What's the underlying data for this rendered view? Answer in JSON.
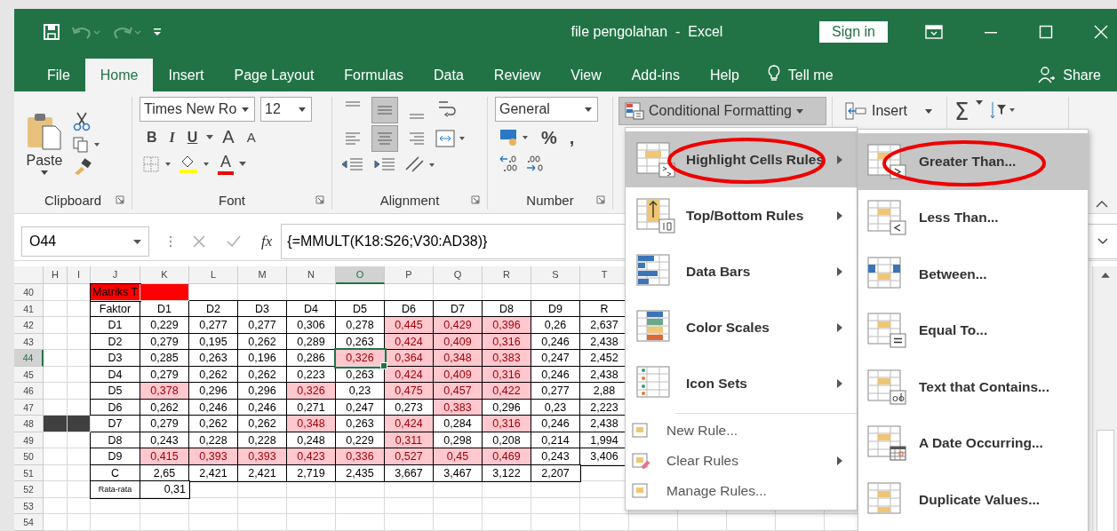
{
  "window": {
    "title": "file pengolahan  -  Excel",
    "sign_in": "Sign in"
  },
  "tabs": [
    {
      "label": "File",
      "selected": false
    },
    {
      "label": "Home",
      "selected": true
    },
    {
      "label": "Insert",
      "selected": false
    },
    {
      "label": "Page Layout",
      "selected": false
    },
    {
      "label": "Formulas",
      "selected": false
    },
    {
      "label": "Data",
      "selected": false
    },
    {
      "label": "Review",
      "selected": false
    },
    {
      "label": "View",
      "selected": false
    },
    {
      "label": "Add-ins",
      "selected": false
    },
    {
      "label": "Help",
      "selected": false
    }
  ],
  "tell_me": "Tell me",
  "share": "Share",
  "ribbon": {
    "clipboard": {
      "label": "Clipboard",
      "paste": "Paste"
    },
    "font": {
      "label": "Font",
      "name": "Times New Ro",
      "size": "12",
      "bold": "B",
      "italic": "I",
      "underline": "U",
      "grow": "A",
      "shrink": "A",
      "color_letter": "A"
    },
    "alignment": {
      "label": "Alignment"
    },
    "number": {
      "label": "Number",
      "format": "General",
      "percent": "%",
      "comma": ","
    },
    "conditional_formatting": {
      "label": "Conditional Formatting",
      "pressed": true
    },
    "insert": "Insert",
    "autosum": "Σ"
  },
  "formula_bar": {
    "name_box": "O44",
    "function_label": "fx",
    "formula": "{=MMULT(K18:S26;V30:AD38)}"
  },
  "sheet": {
    "columns": [
      {
        "label": "H",
        "selected": false
      },
      {
        "label": "I",
        "selected": false
      },
      {
        "label": "J",
        "selected": false
      },
      {
        "label": "K",
        "selected": false
      },
      {
        "label": "L",
        "selected": false
      },
      {
        "label": "M",
        "selected": false
      },
      {
        "label": "N",
        "selected": false
      },
      {
        "label": "O",
        "selected": true
      },
      {
        "label": "P",
        "selected": false
      },
      {
        "label": "Q",
        "selected": false
      },
      {
        "label": "R",
        "selected": false
      },
      {
        "label": "S",
        "selected": false
      },
      {
        "label": "T",
        "selected": false
      }
    ],
    "rows": [
      {
        "number": "40",
        "selected": false,
        "cells": [
          {},
          {},
          {
            "text": "Matriks T",
            "color": "#ff0000"
          },
          {
            "color": "#ff0000"
          }
        ]
      },
      {
        "number": "41",
        "selected": false,
        "cells": [
          {},
          {},
          {
            "text": "Faktor"
          },
          {
            "text": "D1"
          },
          {
            "text": "D2"
          },
          {
            "text": "D3"
          },
          {
            "text": "D4"
          },
          {
            "text": "D5"
          },
          {
            "text": "D6"
          },
          {
            "text": "D7"
          },
          {
            "text": "D8"
          },
          {
            "text": "D9"
          },
          {
            "text": "R"
          }
        ]
      },
      {
        "number": "42",
        "selected": false,
        "cells": [
          {},
          {},
          {
            "text": "D1"
          },
          {
            "text": "0,229",
            "highlighted": false
          },
          {
            "text": "0,277",
            "highlighted": false
          },
          {
            "text": "0,277",
            "highlighted": false
          },
          {
            "text": "0,306",
            "highlighted": false
          },
          {
            "text": "0,278",
            "highlighted": false
          },
          {
            "text": "0,445",
            "highlighted": true
          },
          {
            "text": "0,429",
            "highlighted": true
          },
          {
            "text": "0,396",
            "highlighted": true
          },
          {
            "text": "0,26",
            "highlighted": false
          },
          {
            "text": "2,637"
          }
        ]
      },
      {
        "number": "43",
        "selected": false,
        "cells": [
          {},
          {},
          {
            "text": "D2"
          },
          {
            "text": "0,279",
            "highlighted": false
          },
          {
            "text": "0,195",
            "highlighted": false
          },
          {
            "text": "0,262",
            "highlighted": false
          },
          {
            "text": "0,289",
            "highlighted": false
          },
          {
            "text": "0,263",
            "highlighted": false
          },
          {
            "text": "0,424",
            "highlighted": true
          },
          {
            "text": "0,409",
            "highlighted": true
          },
          {
            "text": "0,316",
            "highlighted": true
          },
          {
            "text": "0,246",
            "highlighted": false
          },
          {
            "text": "2,438"
          }
        ]
      },
      {
        "number": "44",
        "selected": true,
        "cells": [
          {},
          {},
          {
            "text": "D3"
          },
          {
            "text": "0,285",
            "highlighted": false
          },
          {
            "text": "0,263",
            "highlighted": false
          },
          {
            "text": "0,196",
            "highlighted": false
          },
          {
            "text": "0,286",
            "highlighted": false
          },
          {
            "text": "0,326",
            "highlighted": true,
            "selected": true
          },
          {
            "text": "0,364",
            "highlighted": true
          },
          {
            "text": "0,348",
            "highlighted": true
          },
          {
            "text": "0,383",
            "highlighted": true
          },
          {
            "text": "0,247",
            "highlighted": false
          },
          {
            "text": "2,452"
          }
        ]
      },
      {
        "number": "45",
        "selected": false,
        "cells": [
          {},
          {},
          {
            "text": "D4"
          },
          {
            "text": "0,279",
            "highlighted": false
          },
          {
            "text": "0,262",
            "highlighted": false
          },
          {
            "text": "0,262",
            "highlighted": false
          },
          {
            "text": "0,223",
            "highlighted": false
          },
          {
            "text": "0,263",
            "highlighted": false
          },
          {
            "text": "0,424",
            "highlighted": true
          },
          {
            "text": "0,409",
            "highlighted": true
          },
          {
            "text": "0,316",
            "highlighted": true
          },
          {
            "text": "0,246",
            "highlighted": false
          },
          {
            "text": "2,438"
          }
        ]
      },
      {
        "number": "46",
        "selected": false,
        "cells": [
          {},
          {},
          {
            "text": "D5"
          },
          {
            "text": "0,378",
            "highlighted": true
          },
          {
            "text": "0,296",
            "highlighted": false
          },
          {
            "text": "0,296",
            "highlighted": false
          },
          {
            "text": "0,326",
            "highlighted": true
          },
          {
            "text": "0,23",
            "highlighted": false
          },
          {
            "text": "0,475",
            "highlighted": true
          },
          {
            "text": "0,457",
            "highlighted": true
          },
          {
            "text": "0,422",
            "highlighted": true
          },
          {
            "text": "0,277",
            "highlighted": false
          },
          {
            "text": "2,88"
          }
        ]
      },
      {
        "number": "47",
        "selected": false,
        "cells": [
          {},
          {},
          {
            "text": "D6"
          },
          {
            "text": "0,262",
            "highlighted": false
          },
          {
            "text": "0,246",
            "highlighted": false
          },
          {
            "text": "0,246",
            "highlighted": false
          },
          {
            "text": "0,271",
            "highlighted": false
          },
          {
            "text": "0,247",
            "highlighted": false
          },
          {
            "text": "0,273",
            "highlighted": false
          },
          {
            "text": "0,383",
            "highlighted": true
          },
          {
            "text": "0,296",
            "highlighted": false
          },
          {
            "text": "0,23",
            "highlighted": false
          },
          {
            "text": "2,223"
          }
        ]
      },
      {
        "number": "48",
        "selected": false,
        "cells": [
          {
            "color": "#404040"
          },
          {
            "color": "#404040"
          },
          {
            "text": "D7"
          },
          {
            "text": "0,279",
            "highlighted": false
          },
          {
            "text": "0,262",
            "highlighted": false
          },
          {
            "text": "0,262",
            "highlighted": false
          },
          {
            "text": "0,348",
            "highlighted": true
          },
          {
            "text": "0,263",
            "highlighted": false
          },
          {
            "text": "0,424",
            "highlighted": true
          },
          {
            "text": "0,284",
            "highlighted": false
          },
          {
            "text": "0,316",
            "highlighted": true
          },
          {
            "text": "0,246",
            "highlighted": false
          },
          {
            "text": "2,438"
          }
        ]
      },
      {
        "number": "49",
        "selected": false,
        "cells": [
          {},
          {},
          {
            "text": "D8"
          },
          {
            "text": "0,243",
            "highlighted": false
          },
          {
            "text": "0,228",
            "highlighted": false
          },
          {
            "text": "0,228",
            "highlighted": false
          },
          {
            "text": "0,248",
            "highlighted": false
          },
          {
            "text": "0,229",
            "highlighted": false
          },
          {
            "text": "0,311",
            "highlighted": true
          },
          {
            "text": "0,298",
            "highlighted": false
          },
          {
            "text": "0,208",
            "highlighted": false
          },
          {
            "text": "0,214",
            "highlighted": false
          },
          {
            "text": "1,994"
          }
        ]
      },
      {
        "number": "50",
        "selected": false,
        "cells": [
          {},
          {},
          {
            "text": "D9"
          },
          {
            "text": "0,415",
            "highlighted": true
          },
          {
            "text": "0,393",
            "highlighted": true
          },
          {
            "text": "0,393",
            "highlighted": true
          },
          {
            "text": "0,423",
            "highlighted": true
          },
          {
            "text": "0,336",
            "highlighted": true
          },
          {
            "text": "0,527",
            "highlighted": true
          },
          {
            "text": "0,45",
            "highlighted": true
          },
          {
            "text": "0,469",
            "highlighted": true
          },
          {
            "text": "0,243",
            "highlighted": false
          },
          {
            "text": "3,406"
          }
        ]
      },
      {
        "number": "51",
        "selected": false,
        "cells": [
          {},
          {},
          {
            "text": "C"
          },
          {
            "text": "2,65"
          },
          {
            "text": "2,421"
          },
          {
            "text": "2,421"
          },
          {
            "text": "2,719"
          },
          {
            "text": "2,435"
          },
          {
            "text": "3,667"
          },
          {
            "text": "3,467"
          },
          {
            "text": "3,122"
          },
          {
            "text": "2,207"
          }
        ]
      },
      {
        "number": "52",
        "selected": false,
        "cells": [
          {},
          {},
          {
            "text": "Rata-rata",
            "kind": "small"
          },
          {
            "text": "0,31",
            "kind": "right"
          }
        ]
      },
      {
        "number": "53",
        "selected": false,
        "cells": []
      },
      {
        "number": "54",
        "selected": false,
        "cells": []
      }
    ]
  },
  "menu": {
    "items": [
      {
        "kind": "large",
        "label": "Highlight Cells Rules",
        "submenu": true,
        "selected": true,
        "circled": true
      },
      {
        "kind": "large",
        "label": "Top/Bottom Rules",
        "submenu": true,
        "selected": false,
        "circled": false
      },
      {
        "kind": "large",
        "label": "Data Bars",
        "submenu": true,
        "selected": false,
        "circled": false
      },
      {
        "kind": "large",
        "label": "Color Scales",
        "submenu": true,
        "selected": false,
        "circled": false
      },
      {
        "kind": "large",
        "label": "Icon Sets",
        "submenu": true,
        "selected": false,
        "circled": false
      },
      {
        "kind": "small",
        "label": "New Rule...",
        "submenu": false,
        "selected": false,
        "circled": false
      },
      {
        "kind": "small",
        "label": "Clear Rules",
        "submenu": true,
        "selected": false,
        "circled": false
      },
      {
        "kind": "small",
        "label": "Manage Rules...",
        "submenu": false,
        "selected": false,
        "circled": false
      }
    ]
  },
  "submenu": {
    "items": [
      {
        "label": "Greater Than...",
        "selected": true,
        "circled": true
      },
      {
        "label": "Less Than...",
        "selected": false,
        "circled": false
      },
      {
        "label": "Between...",
        "selected": false,
        "circled": false
      },
      {
        "label": "Equal To...",
        "selected": false,
        "circled": false
      },
      {
        "label": "Text that Contains...",
        "selected": false,
        "circled": false
      },
      {
        "label": "A Date Occurring...",
        "selected": false,
        "circled": false
      },
      {
        "label": "Duplicate Values...",
        "selected": false,
        "circled": false
      }
    ]
  }
}
